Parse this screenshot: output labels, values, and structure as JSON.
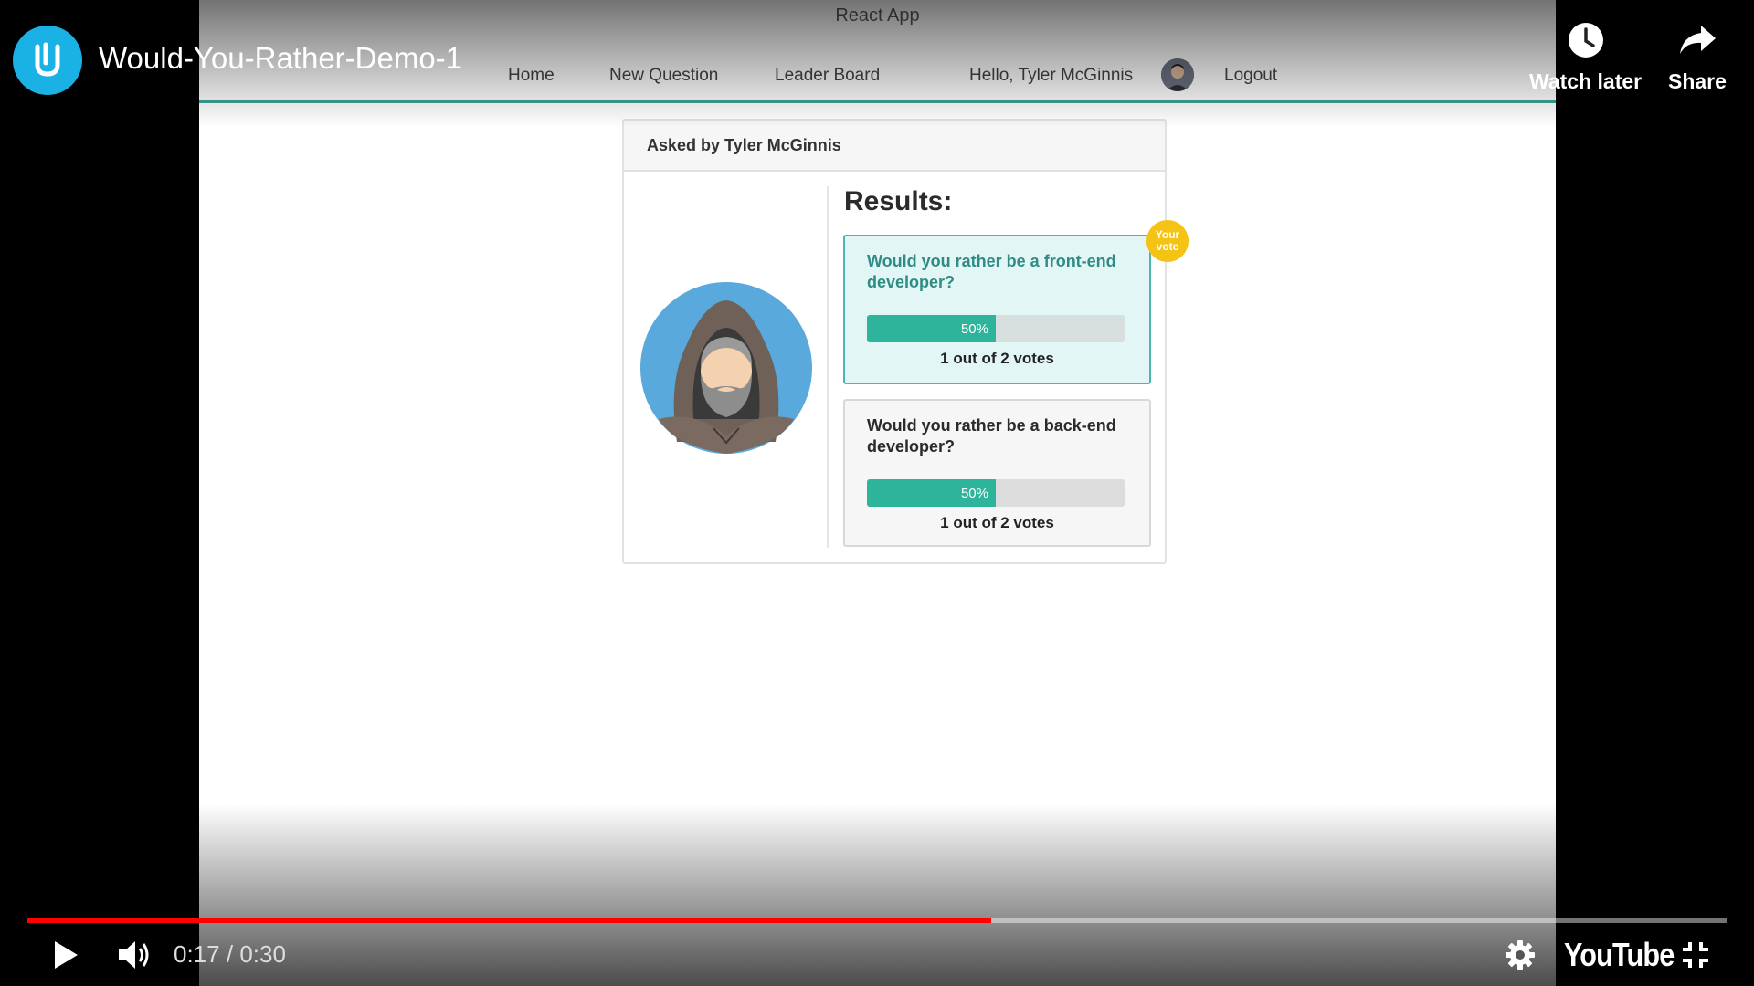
{
  "video": {
    "title": "Would-You-Rather-Demo-1",
    "current_time": "0:17",
    "separator": "/",
    "duration": "0:30",
    "progress_fraction": 0.567,
    "watch_later_label": "Watch later",
    "share_label": "Share",
    "wordmark": "YouTube"
  },
  "app": {
    "window_title": "React App",
    "nav": {
      "home": "Home",
      "new_question": "New Question",
      "leader_board": "Leader Board",
      "greeting": "Hello, Tyler McGinnis",
      "logout": "Logout"
    },
    "question": {
      "asked_by": "Asked by Tyler McGinnis",
      "results_title": "Results:",
      "badge_line1": "Your",
      "badge_line2": "vote",
      "options": [
        {
          "text": "Would you rather be a front-end developer?",
          "percent_label": "50%",
          "percent": 50,
          "votes": "1 out of 2 votes",
          "your_vote": true
        },
        {
          "text": "Would you rather be a back-end developer?",
          "percent_label": "50%",
          "percent": 50,
          "votes": "1 out of 2 votes",
          "your_vote": false
        }
      ]
    }
  },
  "colors": {
    "accent": "#3ba59a",
    "bar_fill": "#2fb49c",
    "badge": "#f4c316",
    "progress": "#ff0000",
    "channel_logo": "#1ab1e4"
  },
  "icons": [
    "udacity-logo-icon",
    "clock-icon",
    "share-arrow-icon",
    "play-icon",
    "volume-icon",
    "settings-gear-icon",
    "exit-fullscreen-icon"
  ]
}
